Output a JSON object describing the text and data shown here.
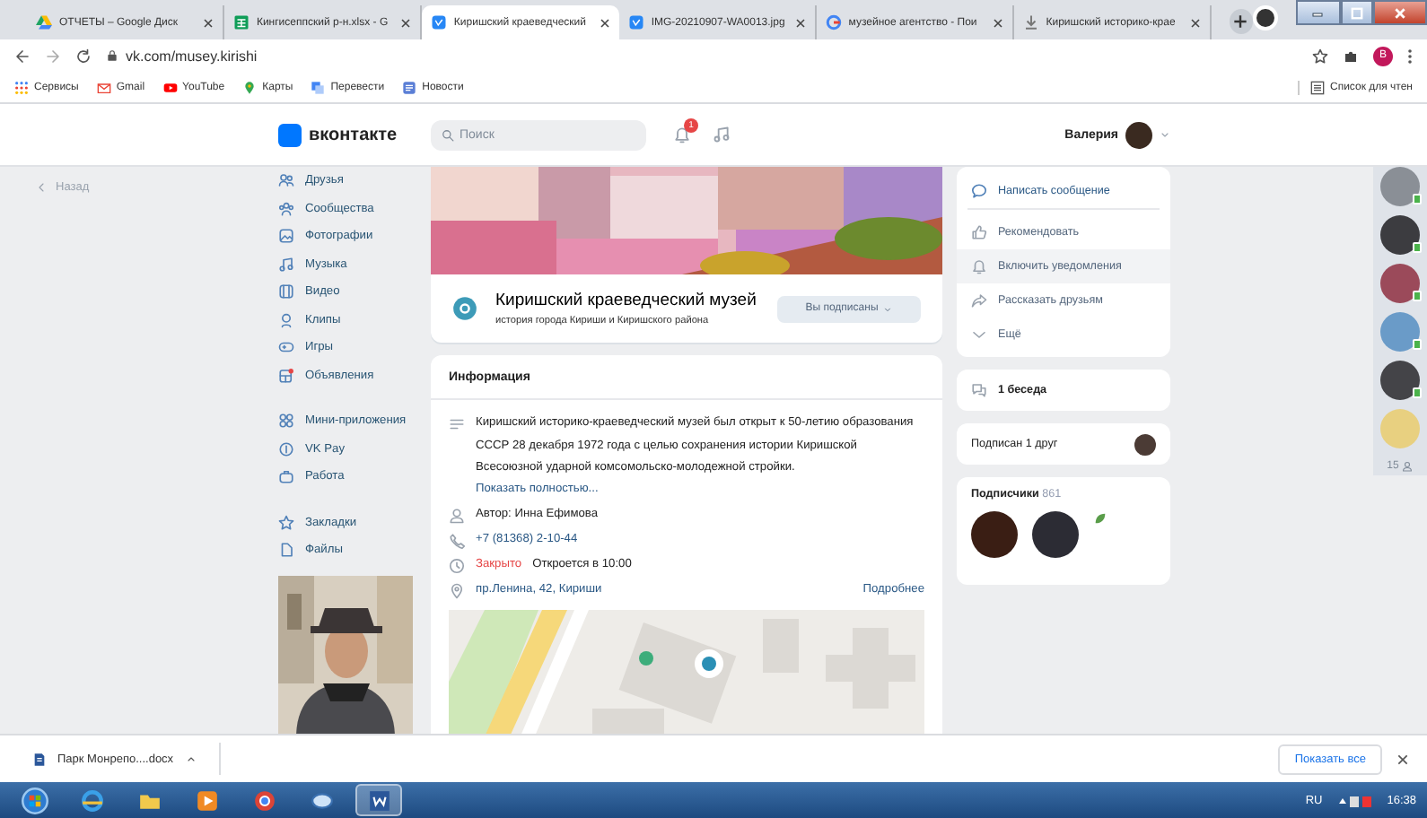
{
  "browser": {
    "tabs": [
      {
        "title": "ОТЧЕТЫ – Google Диск",
        "selected": false
      },
      {
        "title": "Кингисеппский р-н.xlsx - G",
        "selected": false
      },
      {
        "title": "Киришский краеведческий",
        "selected": true
      },
      {
        "title": "IMG-20210907-WA0013.jpg",
        "selected": false
      },
      {
        "title": "музейное агентство - Пои",
        "selected": false
      },
      {
        "title": "Киришский историко-крае",
        "selected": false
      }
    ],
    "url": "vk.com/musey.kirishi",
    "bookmarks": [
      "Сервисы",
      "Gmail",
      "YouTube",
      "Карты",
      "Перевести",
      "Новости"
    ],
    "reading_list": "Список для чтен",
    "profile_initial": "В"
  },
  "vk_header": {
    "logo_text": "вконтакте",
    "search": {
      "placeholder": "Поиск"
    },
    "notification_count": "1",
    "user_name": "Валерия"
  },
  "back_link": "Назад",
  "sidebar": {
    "groups": [
      {
        "items": [
          "Друзья",
          "Сообщества",
          "Фотографии",
          "Музыка",
          "Видео",
          "Клипы",
          "Игры",
          "Объявления"
        ]
      },
      {
        "items": [
          "Мини-приложения",
          "VK Pay",
          "Работа"
        ]
      },
      {
        "items": [
          "Закладки",
          "Файлы"
        ]
      }
    ]
  },
  "group": {
    "name": "Киришский краеведческий музей",
    "status": "история города Кириши и Киришского района",
    "subscribe_button": "Вы подписаны"
  },
  "info": {
    "title": "Информация",
    "description": "Киришский историко-краеведческий музей был открыт к 50-летию образования СССР 28 декабря 1972 года с целью сохранения истории Киришской Всесоюзной ударной комсомольско-молодежной стройки.",
    "show_more": "Показать полностью...",
    "author": "Автор: Инна Ефимова",
    "phone": "+7 (81368) 2-10-44",
    "is_open": false,
    "status": "Закрыто",
    "opens": "Откроется в 10:00",
    "address": "пр.Ленина, 42, Кириши",
    "details": "Подробнее"
  },
  "actions": [
    {
      "label": "Написать сообщение",
      "kind": "primary",
      "highlighted": false
    },
    {
      "label": "Рекомендовать",
      "kind": "action",
      "highlighted": false
    },
    {
      "label": "Включить уведомления",
      "kind": "action",
      "highlighted": true
    },
    {
      "label": "Рассказать друзьям",
      "kind": "action",
      "highlighted": false
    },
    {
      "label": "Ещё",
      "kind": "action",
      "highlighted": false
    }
  ],
  "chats": "1 беседа",
  "friends_subscribed": "Подписан 1 друг",
  "followers": {
    "title": "Подписчики",
    "count": "861"
  },
  "online_strip": {
    "count": "15"
  },
  "download_bar": {
    "file": "Парк Монрепо....docx",
    "show_all": "Показать все"
  },
  "taskbar": {
    "language": "RU",
    "time": "16:38"
  }
}
